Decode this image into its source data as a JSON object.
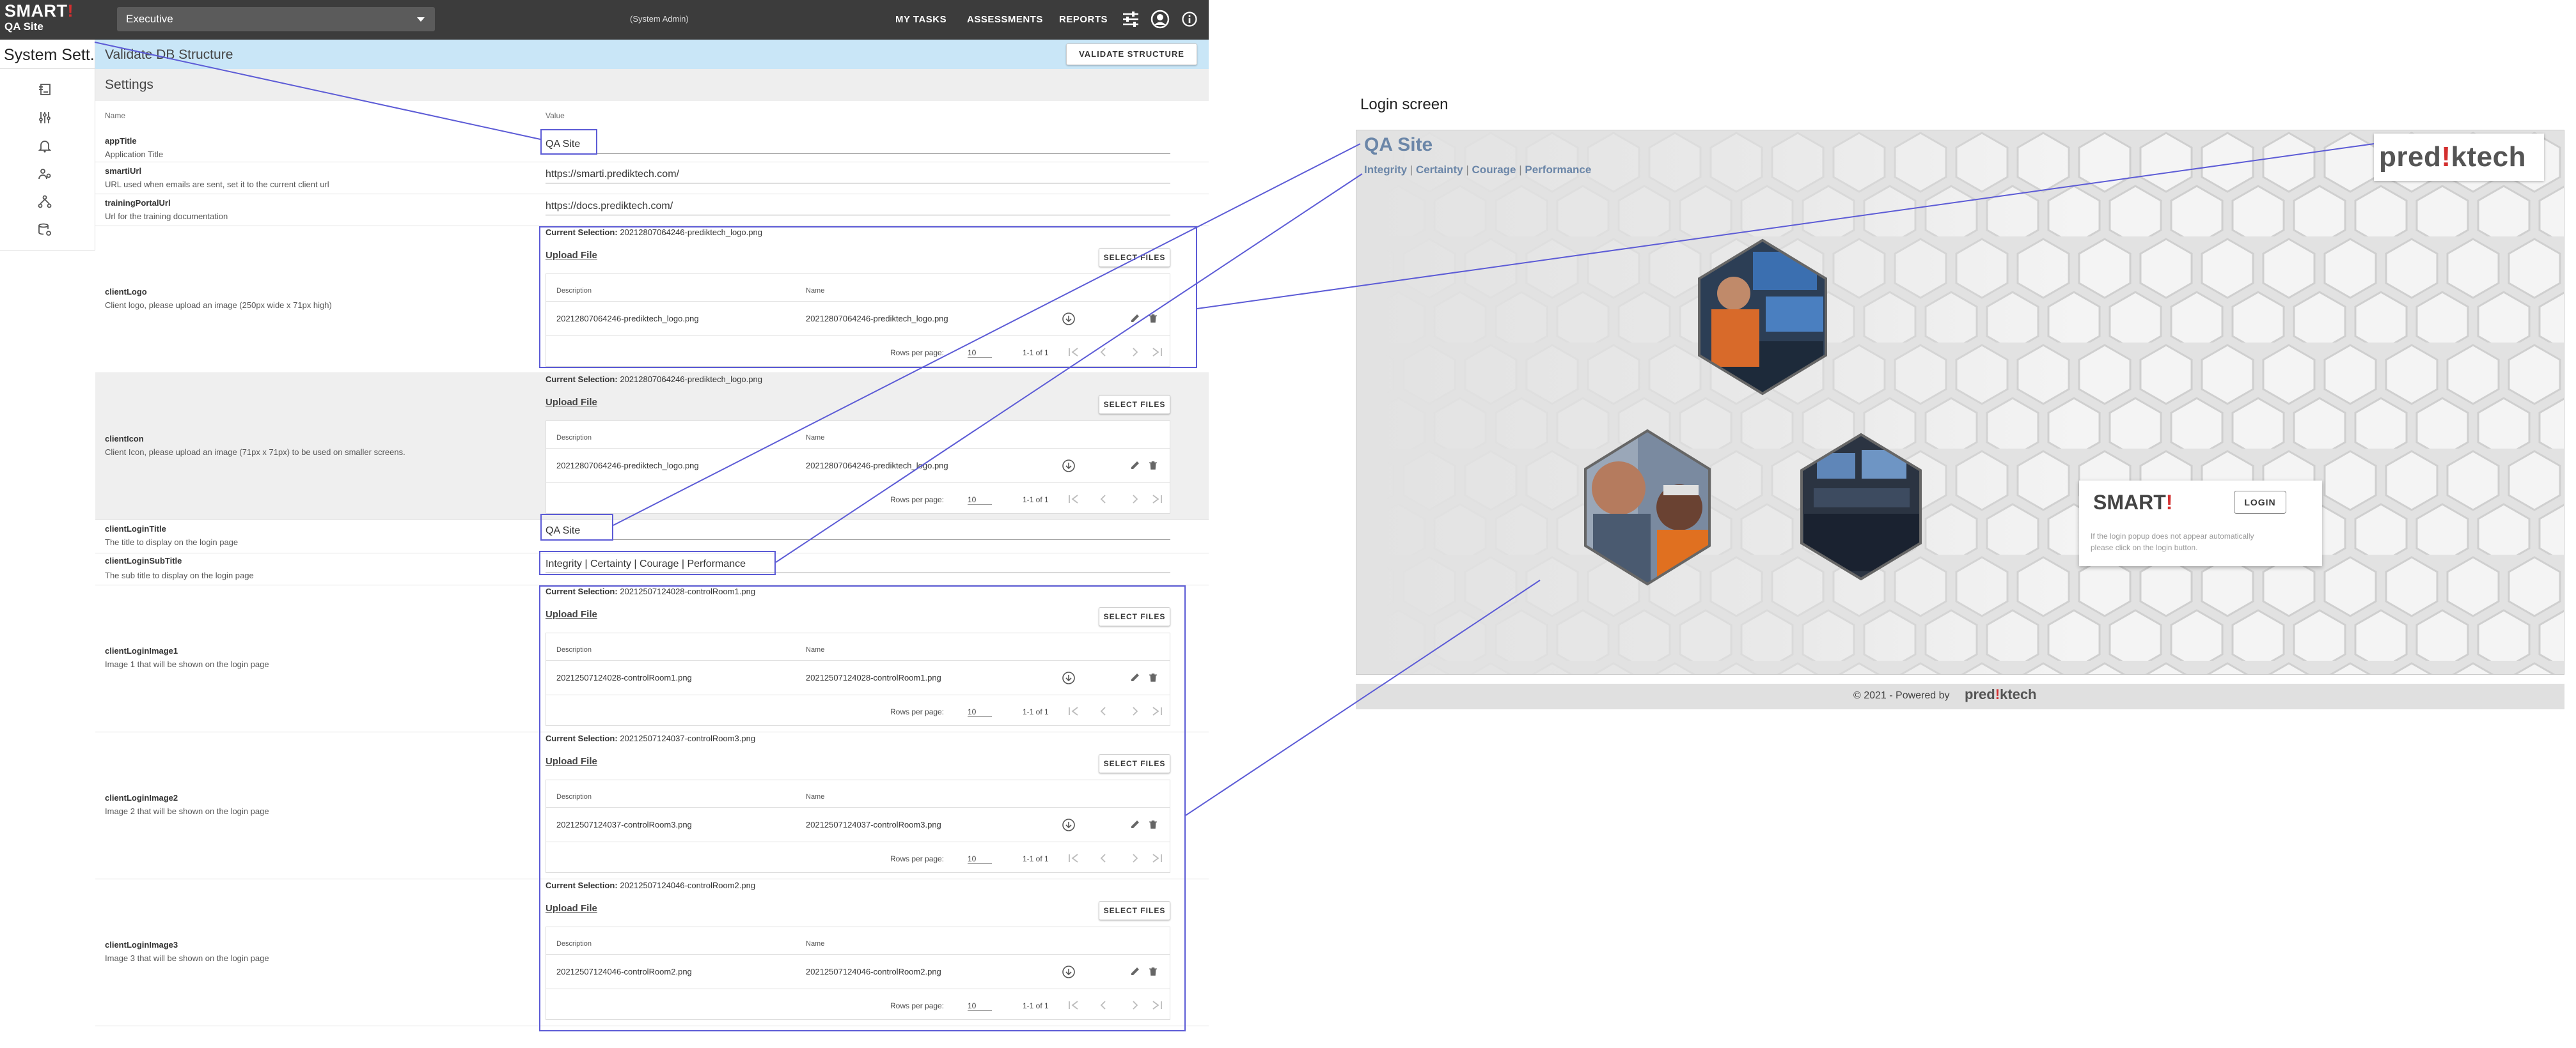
{
  "app": {
    "brand": "SMART",
    "brand_bang": "!",
    "site": "QA Site",
    "organization": "Executive",
    "role": "(System Admin)",
    "nav": {
      "my_tasks": "MY TASKS",
      "assessments": "ASSESSMENTS",
      "reports": "REPORTS"
    },
    "sidebar_title": "System Sett...",
    "page_title": "Validate DB Structure",
    "validate_button": "VALIDATE STRUCTURE",
    "section_title": "Settings",
    "columns": {
      "name": "Name",
      "value": "Value"
    }
  },
  "settings": {
    "appTitle": {
      "name": "appTitle",
      "desc": "Application Title",
      "value": "QA Site"
    },
    "smartiUrl": {
      "name": "smartiUrl",
      "desc": "URL used when emails are sent, set it to the current client url",
      "value": "https://smarti.prediktech.com/"
    },
    "trainingPortalUrl": {
      "name": "trainingPortalUrl",
      "desc": "Url for the training documentation",
      "value": "https://docs.prediktech.com/"
    },
    "clientLogo": {
      "name": "clientLogo",
      "desc": "Client logo, please upload an image (250px wide x 71px high)"
    },
    "clientIcon": {
      "name": "clientIcon",
      "desc": "Client Icon, please upload an image (71px x 71px) to be used on smaller screens."
    },
    "clientLoginTitle": {
      "name": "clientLoginTitle",
      "desc": "The title to display on the login page",
      "value": "QA Site"
    },
    "clientLoginSubTitle": {
      "name": "clientLoginSubTitle",
      "desc": "The sub title to display on the login page",
      "value": "Integrity | Certainty | Courage | Performance"
    },
    "clientLoginImage1": {
      "name": "clientLoginImage1",
      "desc": "Image 1 that will be shown on the login page"
    },
    "clientLoginImage2": {
      "name": "clientLoginImage2",
      "desc": "Image 2 that will be shown on the login page"
    },
    "clientLoginImage3": {
      "name": "clientLoginImage3",
      "desc": "Image 3 that will be shown on the login page"
    }
  },
  "upload": {
    "current_label": "Current Selection:",
    "upload_link": "Upload File",
    "select_button": "SELECT FILES",
    "col_description": "Description",
    "col_name": "Name",
    "rows_per_page": "Rows per page:",
    "rows_value": "10",
    "range": "1-1 of 1",
    "files": {
      "logo": "20212807064246-prediktech_logo.png",
      "icon": "20212807064246-prediktech_logo.png",
      "img1": "20212507124028-controlRoom1.png",
      "img2": "20212507124037-controlRoom3.png",
      "img3": "20212507124046-controlRoom2.png"
    }
  },
  "login_screen": {
    "label": "Login screen",
    "title": "QA Site",
    "subtitle_parts": [
      "Integrity",
      "Certainty",
      "Courage",
      "Performance"
    ],
    "logo_a": "pred",
    "logo_bang": "!",
    "logo_b": "ktech",
    "brand": "SMART",
    "brand_bang": "!",
    "login_button": "LOGIN",
    "popup_note": "If the login popup does not appear automatically please click on the login button.",
    "footer": "© 2021 - Powered by",
    "footer_logo_a": "pred",
    "footer_logo_bang": "!",
    "footer_logo_b": "ktech"
  },
  "colors": {
    "topbar": "#3c3c3c",
    "header_band": "#c9e6f7",
    "highlight": "#5c5bd6",
    "subtitle": "#6b86a8",
    "brand_red": "#d32f2f"
  }
}
